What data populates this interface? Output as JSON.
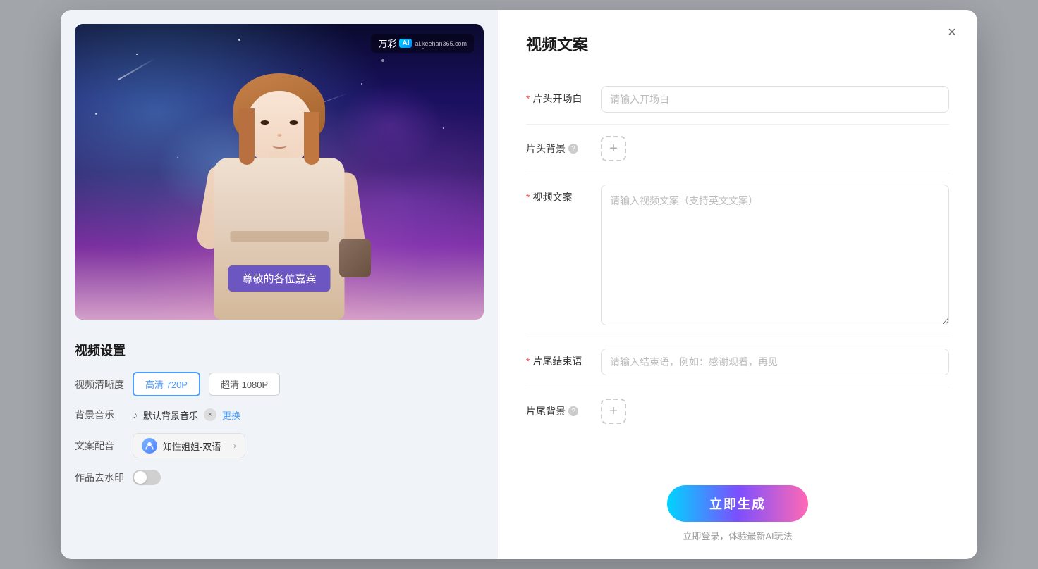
{
  "modal": {
    "close_label": "×",
    "left": {
      "video_preview": {
        "watermark_text": "万彩",
        "ai_badge": "AI",
        "watermark_sub": "ai.keehan365.com",
        "subtitle": "尊敬的各位嘉宾"
      },
      "settings": {
        "title": "视频设置",
        "quality_label": "视频清晰度",
        "quality_options": [
          {
            "label": "高清 720P",
            "active": true
          },
          {
            "label": "超清 1080P",
            "active": false
          }
        ],
        "music_label": "背景音乐",
        "music_icon": "♪",
        "music_name": "默认背景音乐",
        "music_remove": "×",
        "music_change": "更换",
        "voice_label": "文案配音",
        "voice_name": "知性姐姐-双语",
        "voice_arrow": "›",
        "watermark_label": "作品去水印"
      }
    },
    "right": {
      "title": "视频文案",
      "fields": {
        "opening": {
          "label": "片头开场白",
          "required": true,
          "placeholder": "请输入开场白"
        },
        "opening_bg": {
          "label": "片头背景",
          "required": false,
          "help": true
        },
        "copy": {
          "label": "视频文案",
          "required": true,
          "placeholder": "请输入视频文案（支持英文文案）"
        },
        "ending": {
          "label": "片尾结束语",
          "required": true,
          "placeholder": "请输入结束语，例如：感谢观看，再见"
        },
        "ending_bg": {
          "label": "片尾背景",
          "required": false,
          "help": true
        }
      },
      "generate_btn": "立即生成",
      "login_hint": "立即登录，体验最新AI玩法"
    }
  }
}
